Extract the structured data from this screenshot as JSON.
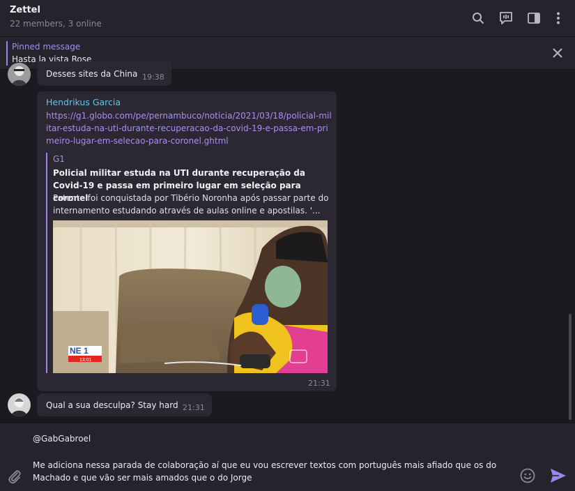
{
  "header": {
    "title": "Zettel",
    "subtitle": "22 members, 3 online"
  },
  "pinned": {
    "title": "Pinned message",
    "text": "Hasta la vista Rose"
  },
  "messages": [
    {
      "text": "Desses sites da China",
      "time": "19:38"
    },
    {
      "sender": "Hendrikus Garcia",
      "link": "https://g1.globo.com/pe/pernambuco/noticia/2021/03/18/policial-militar-estuda-na-uti-durante-recuperacao-da-covid-19-e-passa-em-primeiro-lugar-em-selecao-para-coronel.ghtml",
      "preview": {
        "site": "G1",
        "title": "Policial militar estuda na UTI durante recuperação da Covid-19 e passa em primeiro lugar em seleção para coronel",
        "description": "Patente foi conquistada por Tibério Noronha após passar parte do internamento estudando através de aulas online e apostilas. '...",
        "image_logo": "NE 1",
        "image_clock": "13:01"
      },
      "time": "21:31"
    },
    {
      "text": "Qual a sua desculpa? Stay hard",
      "time": "21:31"
    }
  ],
  "composer": {
    "line1": "@GabGabroel",
    "line2": "Me adiciona nessa parada de colaboração aí que eu vou escrever textos com português mais afiado que os do Machado e que vão ser mais amados que o do Jorge"
  },
  "icons": {
    "search": "search-icon",
    "voice_chat": "voice-chat-icon",
    "sidebar": "sidebar-toggle-icon",
    "menu": "more-vertical-icon",
    "close": "close-icon",
    "attach": "paperclip-icon",
    "emoji": "emoji-icon",
    "send": "send-icon"
  },
  "colors": {
    "accent": "#9b85e9",
    "sender": "#62c4e6",
    "link": "#a890f2",
    "bubble": "#2b2833",
    "background": "#1b1a20"
  }
}
